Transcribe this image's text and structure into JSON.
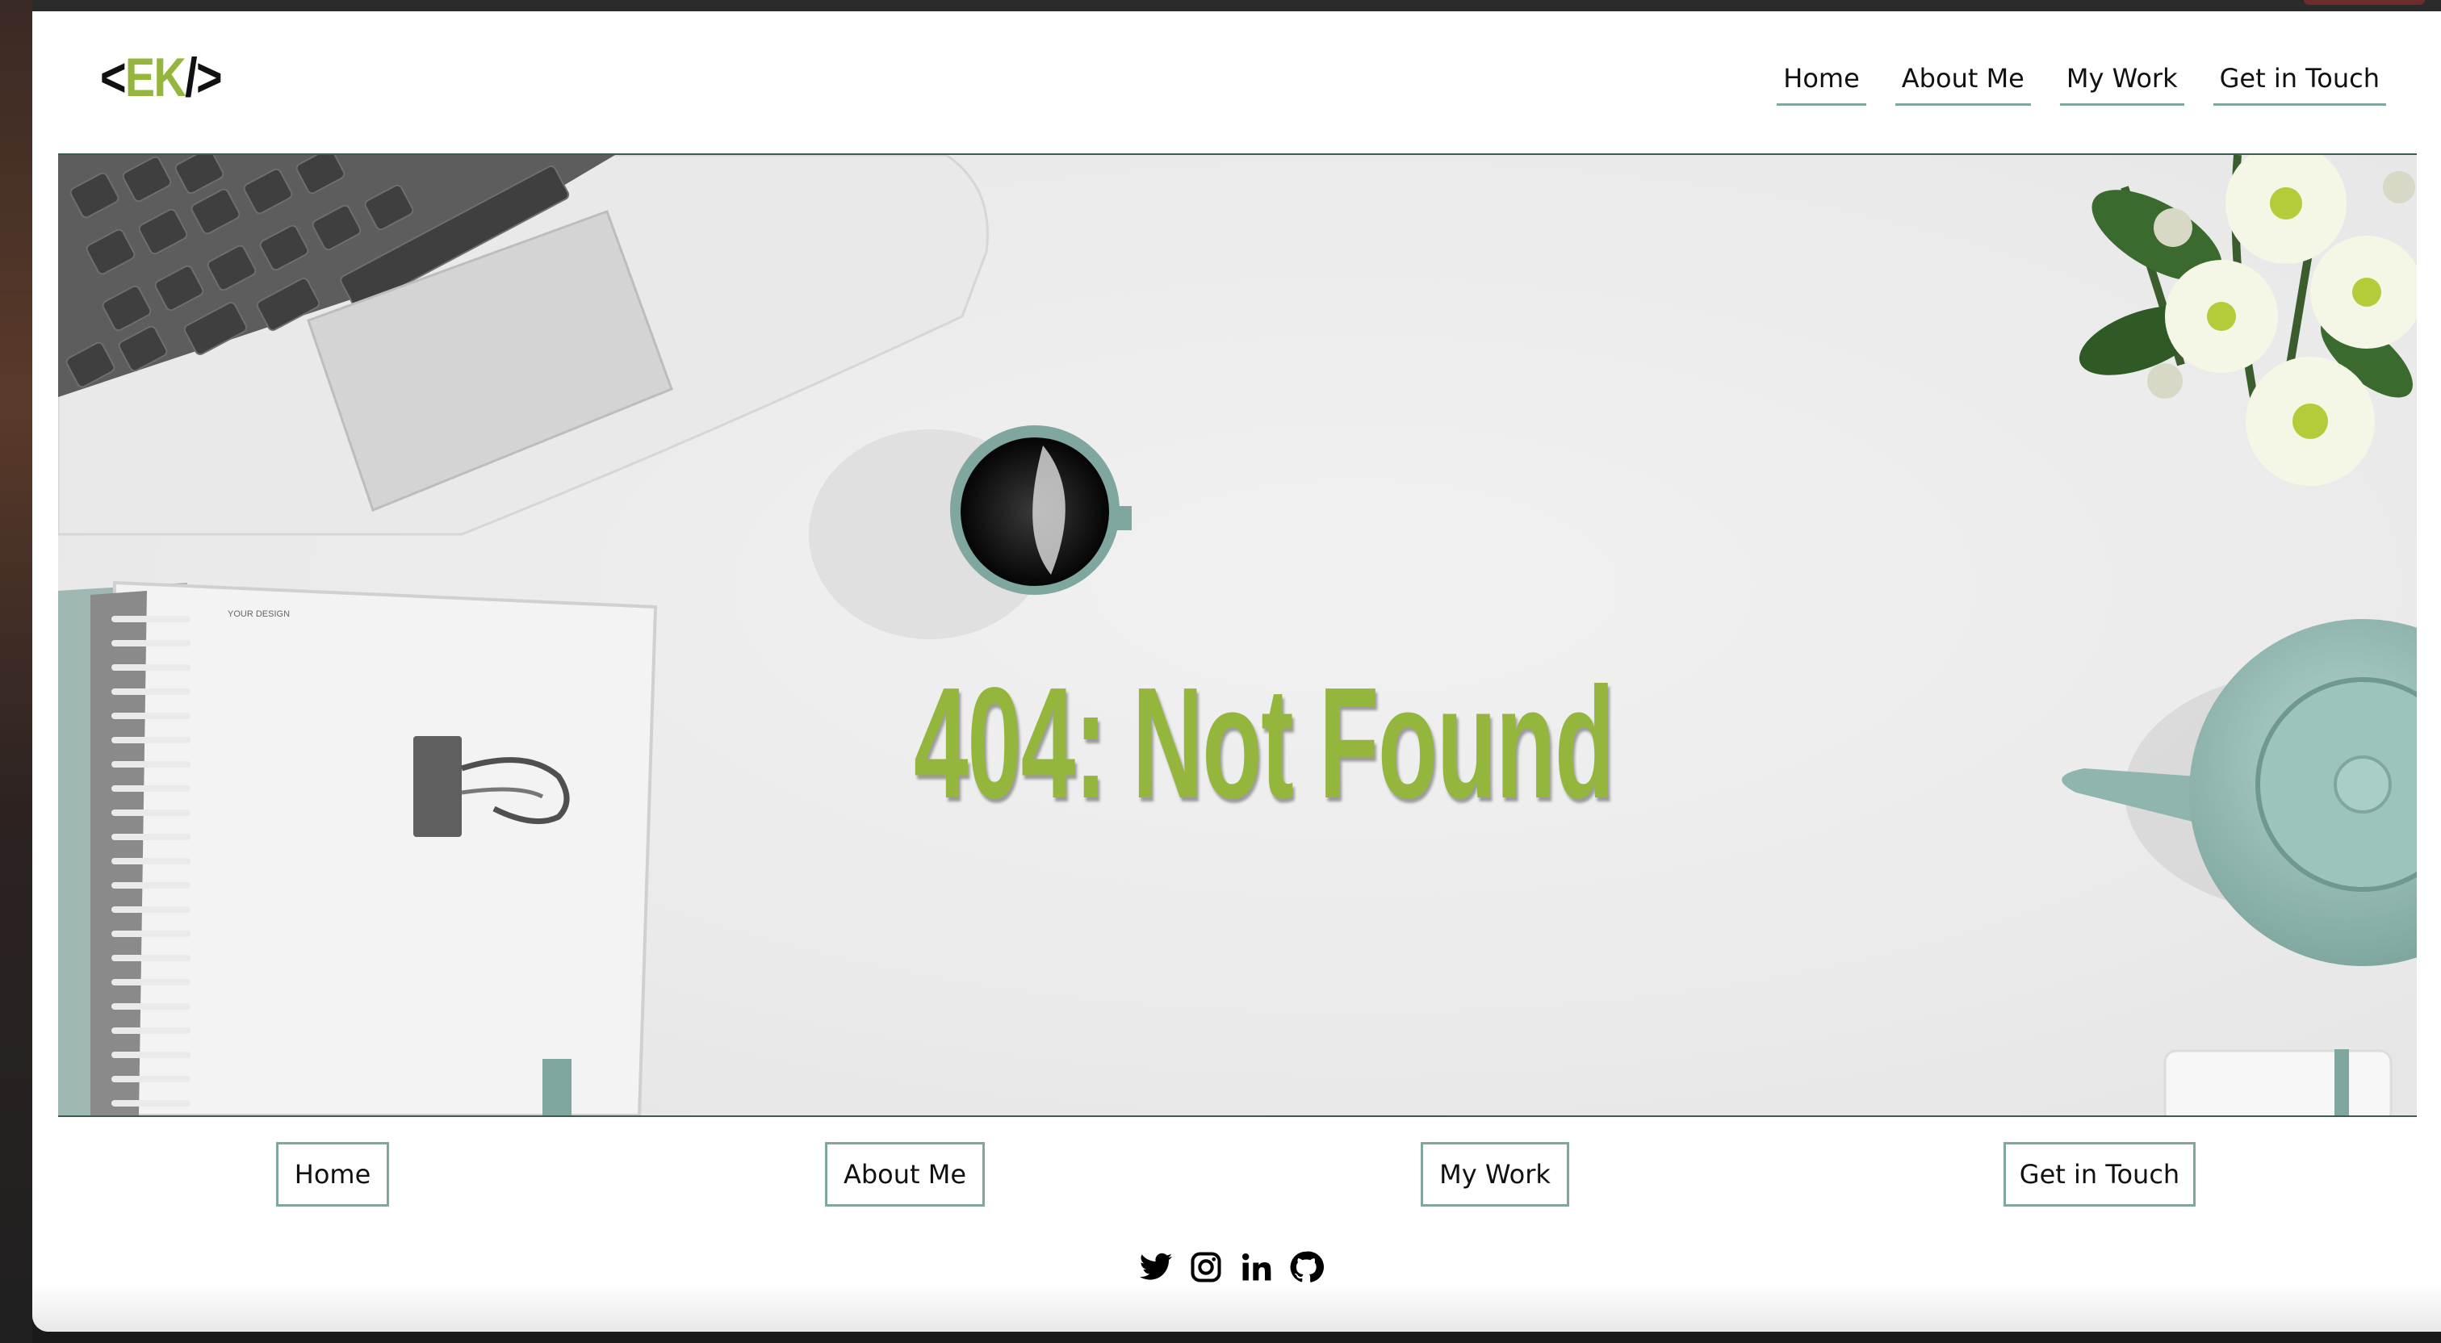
{
  "logo": {
    "open": "<",
    "initials": "EK",
    "close": "/>"
  },
  "nav": {
    "items": [
      {
        "label": "Home"
      },
      {
        "label": "About Me"
      },
      {
        "label": "My Work"
      },
      {
        "label": "Get in Touch"
      }
    ]
  },
  "hero": {
    "title": "404: Not Found",
    "notebook_label": "YOUR DESIGN"
  },
  "footer": {
    "buttons": [
      {
        "label": "Home"
      },
      {
        "label": "About Me"
      },
      {
        "label": "My Work"
      },
      {
        "label": "Get in Touch"
      }
    ],
    "social": [
      {
        "icon": "twitter-icon"
      },
      {
        "icon": "instagram-icon"
      },
      {
        "icon": "linkedin-icon"
      },
      {
        "icon": "github-icon"
      }
    ]
  },
  "colors": {
    "accent": "#95b63c",
    "border": "#7fa7a0",
    "divider": "#3d5c4f"
  }
}
